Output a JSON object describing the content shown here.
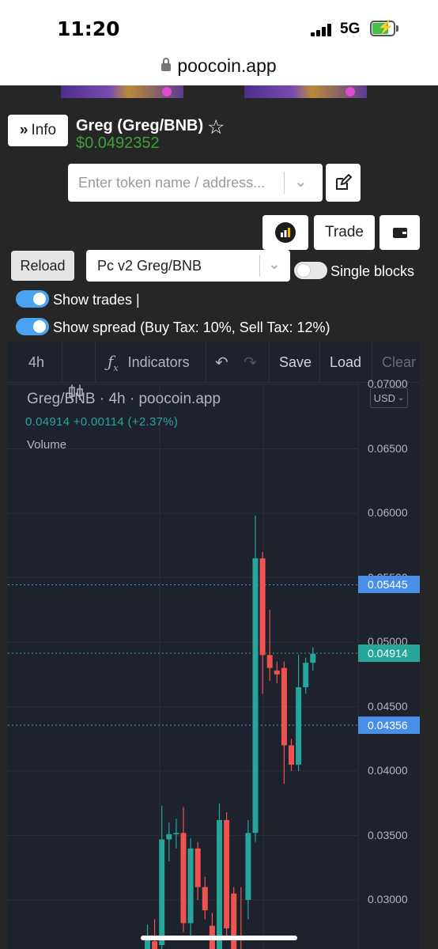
{
  "status_bar": {
    "time": "11:20",
    "network": "5G"
  },
  "browser": {
    "url": "poocoin.app"
  },
  "header": {
    "info_label": "Info",
    "token_title": "Greg (Greg/BNB)",
    "token_price": "$0.0492352"
  },
  "search": {
    "placeholder": "Enter token name / address..."
  },
  "toolbar": {
    "trade_label": "Trade",
    "reload_label": "Reload",
    "pair_selected": "Pc v2 Greg/BNB"
  },
  "toggles": {
    "single_blocks": {
      "label": "Single blocks",
      "on": false
    },
    "show_trades": {
      "label": "Show trades |",
      "on": true
    },
    "show_spread": {
      "label": "Show spread (Buy Tax: 10%, Sell Tax: 12%)",
      "on": true
    }
  },
  "chart_toolbar": {
    "interval": "4h",
    "indicators_label": "Indicators",
    "save_label": "Save",
    "load_label": "Load",
    "clear_label": "Clear"
  },
  "chart_legend": {
    "title": "Greg/BNB · 4h · poocoin.app",
    "values": "0.04914  +0.00114  (+2.37%)",
    "volume_label": "Volume",
    "currency": "USD"
  },
  "colors": {
    "up": "#26a69a",
    "down": "#ef5350",
    "spread_line": "#4a8fe7",
    "price_green": "#3ca03c"
  },
  "chart_data": {
    "type": "candlestick",
    "y_ticks": [
      "0.07000",
      "0.06500",
      "0.06000",
      "0.05500",
      "0.05000",
      "0.04500",
      "0.04000",
      "0.03500",
      "0.03000"
    ],
    "price_labels": {
      "buy_spread": "0.05445",
      "last_price": "0.04914",
      "sell_spread": "0.04356"
    },
    "candles": [
      {
        "o": 0.0255,
        "h": 0.0281,
        "l": 0.024,
        "c": 0.027
      },
      {
        "o": 0.0268,
        "h": 0.0285,
        "l": 0.0245,
        "c": 0.0262
      },
      {
        "o": 0.0265,
        "h": 0.0373,
        "l": 0.0255,
        "c": 0.0347
      },
      {
        "o": 0.0347,
        "h": 0.036,
        "l": 0.033,
        "c": 0.0351
      },
      {
        "o": 0.0351,
        "h": 0.0363,
        "l": 0.034,
        "c": 0.0352
      },
      {
        "o": 0.0352,
        "h": 0.0372,
        "l": 0.0275,
        "c": 0.0282
      },
      {
        "o": 0.0282,
        "h": 0.0348,
        "l": 0.027,
        "c": 0.034
      },
      {
        "o": 0.034,
        "h": 0.0345,
        "l": 0.03,
        "c": 0.031
      },
      {
        "o": 0.031,
        "h": 0.0318,
        "l": 0.0285,
        "c": 0.0292
      },
      {
        "o": 0.028,
        "h": 0.029,
        "l": 0.025,
        "c": 0.026
      },
      {
        "o": 0.026,
        "h": 0.0375,
        "l": 0.0255,
        "c": 0.0362
      },
      {
        "o": 0.0362,
        "h": 0.0368,
        "l": 0.027,
        "c": 0.0278
      },
      {
        "o": 0.0305,
        "h": 0.031,
        "l": 0.025,
        "c": 0.026
      },
      {
        "o": 0.026,
        "h": 0.031,
        "l": 0.024,
        "c": 0.025
      },
      {
        "o": 0.03,
        "h": 0.0362,
        "l": 0.0285,
        "c": 0.0352
      },
      {
        "o": 0.0352,
        "h": 0.0598,
        "l": 0.0345,
        "c": 0.0565
      },
      {
        "o": 0.0565,
        "h": 0.057,
        "l": 0.046,
        "c": 0.049
      },
      {
        "o": 0.049,
        "h": 0.0525,
        "l": 0.047,
        "c": 0.048
      },
      {
        "o": 0.0478,
        "h": 0.0485,
        "l": 0.0468,
        "c": 0.0475
      },
      {
        "o": 0.048,
        "h": 0.0485,
        "l": 0.039,
        "c": 0.042
      },
      {
        "o": 0.042,
        "h": 0.0425,
        "l": 0.04,
        "c": 0.0405
      },
      {
        "o": 0.0405,
        "h": 0.049,
        "l": 0.04,
        "c": 0.0465
      },
      {
        "o": 0.0465,
        "h": 0.0488,
        "l": 0.046,
        "c": 0.0484
      },
      {
        "o": 0.0484,
        "h": 0.0496,
        "l": 0.0478,
        "c": 0.0491
      }
    ]
  }
}
